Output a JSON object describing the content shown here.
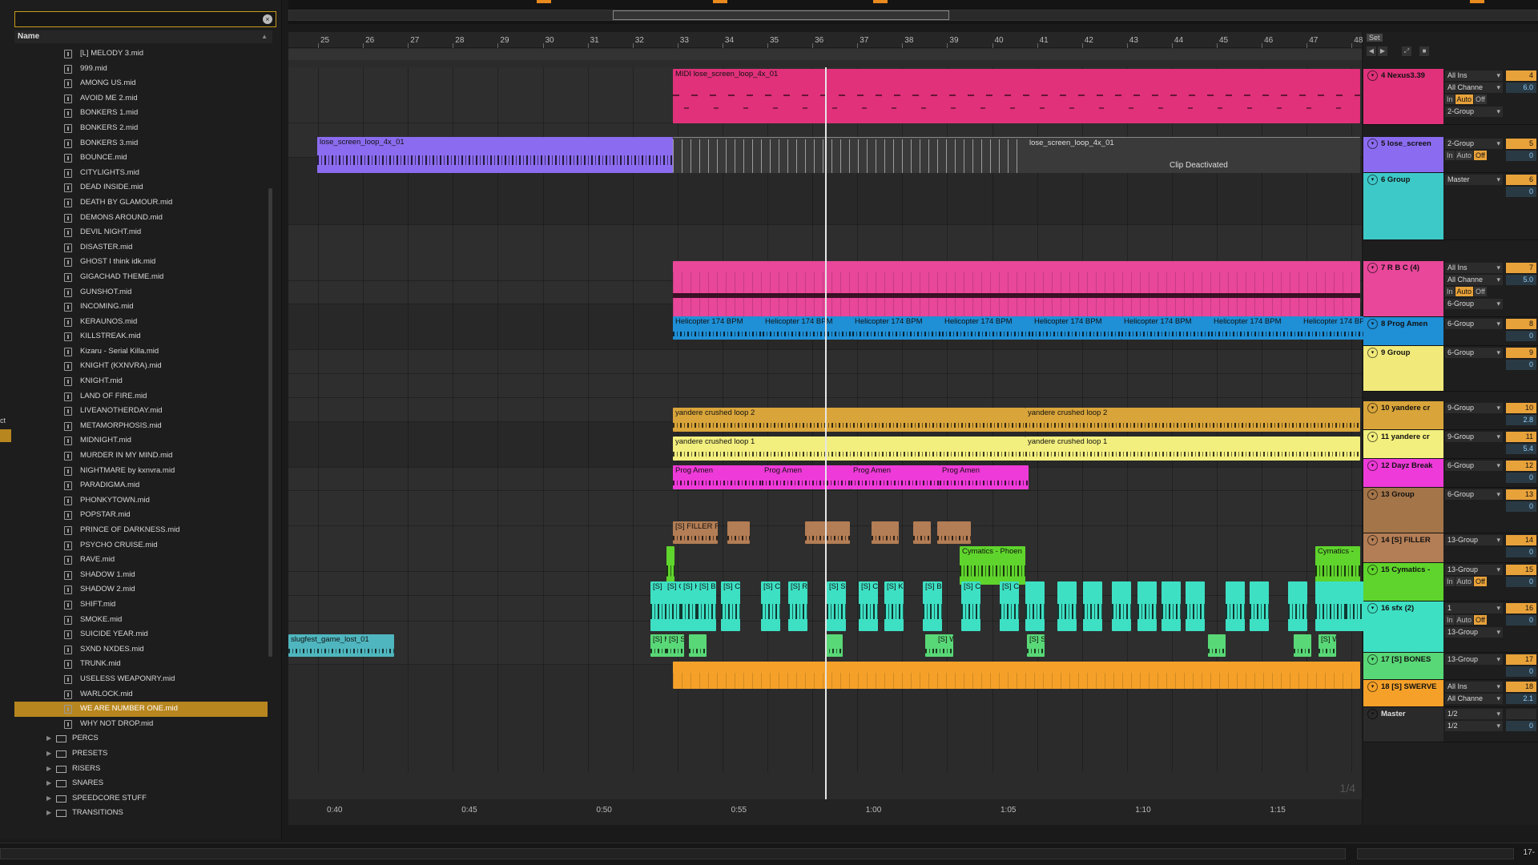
{
  "browser": {
    "column_header": "Name",
    "files": [
      "[L] MELODY 3.mid",
      "999.mid",
      "AMONG US.mid",
      "AVOID ME 2.mid",
      "BONKERS 1.mid",
      "BONKERS 2.mid",
      "BONKERS 3.mid",
      "BOUNCE.mid",
      "CITYLIGHTS.mid",
      "DEAD INSIDE.mid",
      "DEATH BY GLAMOUR.mid",
      "DEMONS AROUND.mid",
      "DEVIL NIGHT.mid",
      "DISASTER.mid",
      "GHOST I think idk.mid",
      "GIGACHAD THEME.mid",
      "GUNSHOT.mid",
      "INCOMING.mid",
      "KERAUNOS.mid",
      "KILLSTREAK.mid",
      "Kizaru - Serial Killa.mid",
      "KNIGHT (KXNVRA).mid",
      "KNIGHT.mid",
      "LAND OF FIRE.mid",
      "LIVEANOTHERDAY.mid",
      "METAMORPHOSIS.mid",
      "MIDNIGHT.mid",
      "MURDER IN MY MIND.mid",
      "NIGHTMARE by kxnvra.mid",
      "PARADIGMA.mid",
      "PHONKYTOWN.mid",
      "POPSTAR.mid",
      "PRINCE OF DARKNESS.mid",
      "PSYCHO CRUISE.mid",
      "RAVE.mid",
      "SHADOW 1.mid",
      "SHADOW 2.mid",
      "SHIFT.mid",
      "SMOKE.mid",
      "SUICIDE YEAR.mid",
      "SXND NXDES.mid",
      "TRUNK.mid",
      "USELESS WEAPONRY.mid",
      "WARLOCK.mid",
      "WE ARE NUMBER ONE.mid",
      "WHY NOT DROP.mid"
    ],
    "selected_file": "WE ARE NUMBER ONE.mid",
    "folders": [
      "PERCS",
      "PRESETS",
      "RISERS",
      "SNARES",
      "SPEEDCORE STUFF",
      "TRANSITIONS"
    ],
    "left_stub": "ct"
  },
  "ruler": {
    "bars": [
      "25",
      "26",
      "27",
      "28",
      "29",
      "30",
      "31",
      "32",
      "33",
      "34",
      "35",
      "36",
      "37",
      "38",
      "39",
      "40",
      "41",
      "42",
      "43",
      "44",
      "45",
      "46",
      "47",
      "48"
    ],
    "times": [
      "0:40",
      "0:45",
      "0:50",
      "0:55",
      "1:00",
      "1:05",
      "1:10",
      "1:15"
    ],
    "zoom": "1/4"
  },
  "clips": {
    "midi_nexus": "MIDI lose_screen_loop_4x_01",
    "lose_screen_left": "lose_screen_loop_4x_01",
    "lose_screen_right": "lose_screen_loop_4x_01",
    "clip_deactivated": "Clip Deactivated",
    "helicopter": "Helicopter 174 BPM",
    "yandere_2": "yandere crushed loop 2",
    "yandere_1": "yandere crushed loop 1",
    "prog_amen": "Prog Amen",
    "filler": "[S] FILLER F",
    "cymatics": "Cymatics - Phoen",
    "cymatics_right": "Cymatics -",
    "slugfest": "slugfest_game_lost_01",
    "sfx_labels": [
      "[S] SI",
      "[S] CHEV",
      "[S] KO",
      "[S] BI",
      "[S] CH",
      "[S] CI",
      "[S] RA",
      "[S] SI",
      "[S] CHEV",
      "[S] KO",
      "[S] BI",
      "[S] CH",
      "[S] CI"
    ],
    "bones_labels": [
      "[S] M",
      "[S] S",
      "[S] WA",
      "[S] S",
      "[S] WA"
    ]
  },
  "set_button": "Set",
  "tracks": [
    {
      "name": "4 Nexus3.39",
      "color": "#e0317a",
      "io": [
        "All Ins",
        "All Channe",
        "2-Group"
      ],
      "monitor": [
        "In",
        "Auto",
        "Off"
      ],
      "monitor_on": "Auto",
      "num": "4",
      "vol": "6.0"
    },
    {
      "name": "5 lose_screen",
      "color": "#8b6cf0",
      "io": [
        "2-Group"
      ],
      "monitor": [
        "In",
        "Auto",
        "Off"
      ],
      "monitor_on": "Off",
      "num": "5",
      "vol": "0"
    },
    {
      "name": "6 Group",
      "color": "#3ec9c9",
      "io": [
        "Master"
      ],
      "num": "6",
      "vol": "0"
    },
    {
      "name": "7 R B C (4)",
      "color": "#e8479a",
      "io": [
        "All Ins",
        "All Channe",
        "6-Group"
      ],
      "monitor": [
        "In",
        "Auto",
        "Off"
      ],
      "monitor_on": "Auto",
      "num": "7",
      "vol": "5.0"
    },
    {
      "name": "8 Prog Amen",
      "color": "#1f8fd6",
      "io": [
        "6-Group"
      ],
      "num": "8",
      "vol": "0"
    },
    {
      "name": "9 Group",
      "color": "#f1ea7a",
      "io": [
        "6-Group"
      ],
      "num": "9",
      "vol": "0"
    },
    {
      "name": "10 yandere cr",
      "color": "#d9a53a",
      "io": [
        "9-Group"
      ],
      "num": "10",
      "vol": "2.8"
    },
    {
      "name": "11 yandere cr",
      "color": "#f3ef7e",
      "io": [
        "9-Group"
      ],
      "num": "11",
      "vol": "5.4"
    },
    {
      "name": "12 Dayz Break",
      "color": "#ee3ad8",
      "io": [
        "6-Group"
      ],
      "num": "12",
      "vol": "0"
    },
    {
      "name": "13 Group",
      "color": "#a47549",
      "io": [
        "6-Group"
      ],
      "num": "13",
      "vol": "0"
    },
    {
      "name": "14 [S] FILLER",
      "color": "#b37d55",
      "io": [
        "13-Group"
      ],
      "num": "14",
      "vol": "0"
    },
    {
      "name": "15 Cymatics -",
      "color": "#5fd42c",
      "io": [
        "13-Group"
      ],
      "monitor": [
        "In",
        "Auto",
        "Off"
      ],
      "monitor_on": "Off",
      "num": "15",
      "vol": "0"
    },
    {
      "name": "16 sfx (2)",
      "color": "#3ee0c4",
      "io": [
        "1",
        "13-Group"
      ],
      "monitor": [
        "In",
        "Auto",
        "Off"
      ],
      "monitor_on": "Off",
      "num": "16",
      "vol": "0"
    },
    {
      "name": "17 [S] BONES",
      "color": "#59d877",
      "io": [
        "13-Group"
      ],
      "num": "17",
      "vol": "0"
    },
    {
      "name": "18 [S] SWERVE",
      "color": "#f5a129",
      "io": [
        "All Ins",
        "All Channe"
      ],
      "num": "18",
      "vol": "2.1"
    },
    {
      "name": "Master",
      "color": "#2a2a2a",
      "io": [
        "1/2",
        "1/2"
      ],
      "num": "",
      "vol": "0"
    }
  ],
  "position_readout": "17-"
}
